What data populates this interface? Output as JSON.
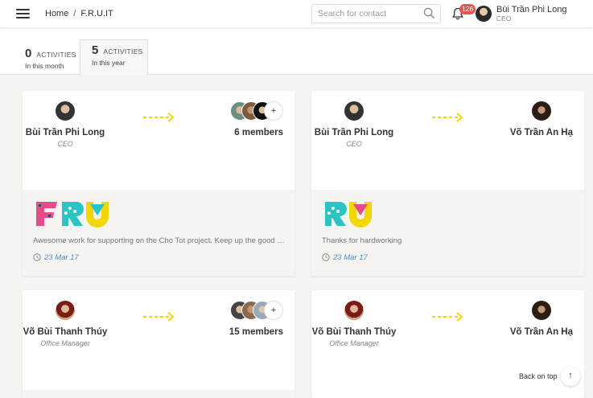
{
  "header": {
    "breadcrumb": [
      "Home",
      "F.R.U.IT"
    ],
    "breadcrumb_sep": "/",
    "search_placeholder": "Search for contact",
    "notifications_count": "126",
    "user_name": "Bùi Trần Phi Long",
    "user_role": "CEO"
  },
  "tabs": [
    {
      "number": "0",
      "caption": "ACTIVITIES",
      "period": "In this month"
    },
    {
      "number": "5",
      "caption": "ACTIVITIES",
      "period": "In this year"
    }
  ],
  "cards": [
    {
      "from_name": "Bùi Trần Phi Long",
      "from_role": "CEO",
      "to_label": "6 members",
      "logo": "FRU",
      "message": "Awesome work for supporting on the Cho Tot project. Keep up the good work!",
      "date": "23 Mar 17"
    },
    {
      "from_name": "Bùi Trần Phi Long",
      "from_role": "CEO",
      "to_label": "Võ Trần An Hạ",
      "logo": "RU",
      "message": "Thanks for hardworking",
      "date": "23 Mar 17"
    },
    {
      "from_name": "Võ Bùi Thanh Thúy",
      "from_role": "Office Manager",
      "to_label": "15 members"
    },
    {
      "from_name": "Võ Bùi Thanh Thúy",
      "from_role": "Office Manager",
      "to_label": "Võ Trần An Hạ"
    }
  ],
  "plus_label": "+",
  "back_to_top": "Back on top",
  "back_to_top_icon": "↑",
  "colors": {
    "arrow": "#f2d600",
    "date": "#4a8fd6",
    "badge": "#e9534f",
    "strip_brown": "#a37a68",
    "strip_green": "#2ecc71"
  }
}
